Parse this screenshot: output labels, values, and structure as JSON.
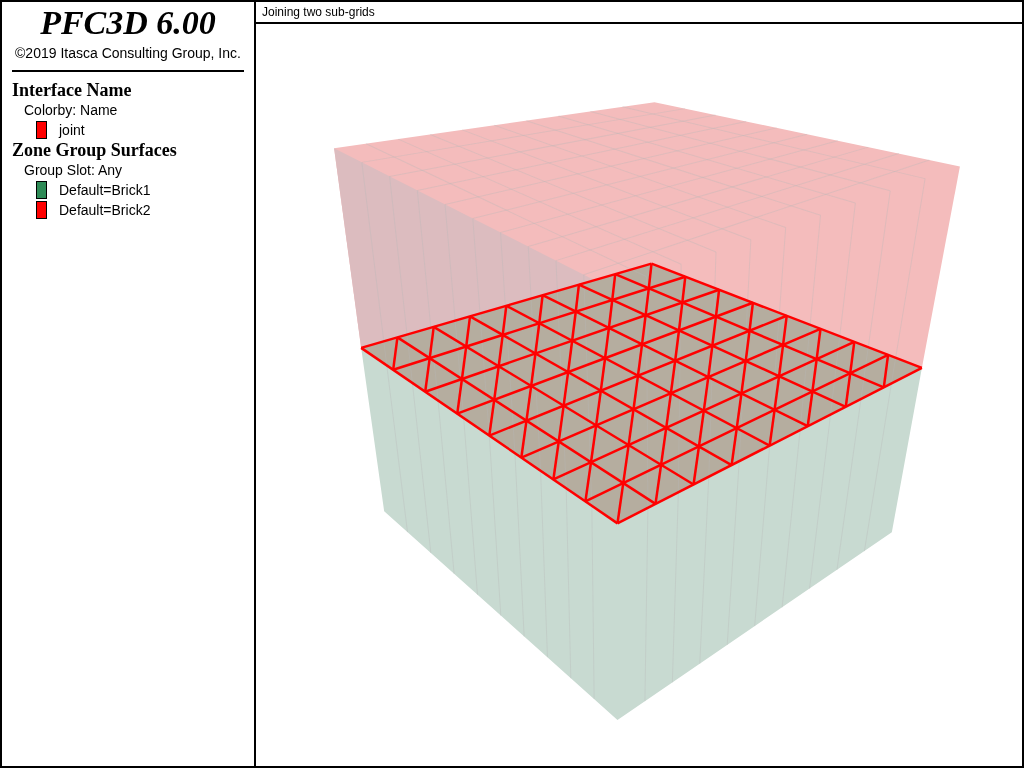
{
  "app": {
    "title": "PFC3D 6.00",
    "copyright": "©2019 Itasca Consulting Group, Inc."
  },
  "legend": [
    {
      "heading": "Interface Name",
      "subheading": "Colorby: Name",
      "items": [
        {
          "label": "joint",
          "color": "#ff0000"
        }
      ]
    },
    {
      "heading": "Zone Group Surfaces",
      "subheading": "Group Slot: Any",
      "items": [
        {
          "label": "Default=Brick1",
          "color": "#2e8b57"
        },
        {
          "label": "Default=Brick2",
          "color": "#ff0000"
        }
      ]
    }
  ],
  "view": {
    "title": "Joining two sub-grids"
  }
}
